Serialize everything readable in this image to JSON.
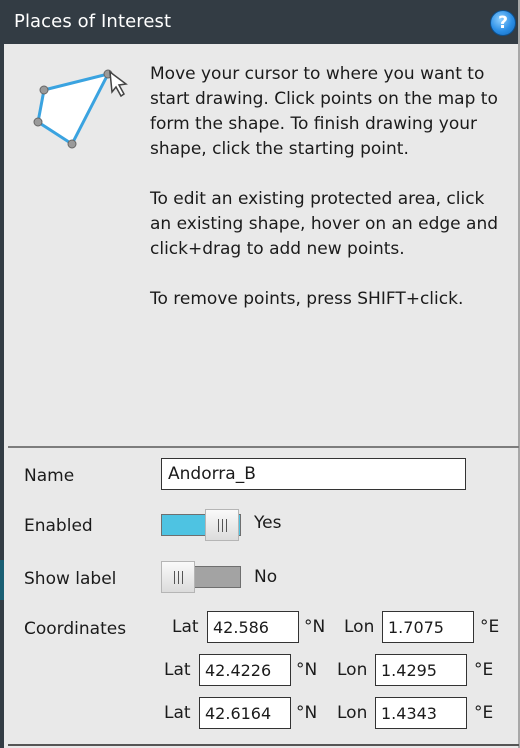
{
  "header": {
    "title": "Places of Interest",
    "help_glyph": "?",
    "help_icon": "help-circle-icon"
  },
  "instructions": {
    "icon": "polygon-draw-icon",
    "paragraphs": [
      "Move your cursor to where you want to start drawing. Click points on the map to form the shape. To finish drawing your shape, click the starting point.",
      "To edit an existing protected area, click an existing shape, hover on an edge and click+drag to add new points.",
      "To remove points, press SHIFT+click."
    ]
  },
  "form": {
    "name_label": "Name",
    "name_value": "Andorra_B",
    "enabled_label": "Enabled",
    "enabled_state": true,
    "enabled_text": "Yes",
    "show_label_label": "Show label",
    "show_label_state": false,
    "show_label_text": "No",
    "coordinates_label": "Coordinates",
    "coordinates": [
      {
        "lat_label": "Lat",
        "lat": "42.586",
        "lat_unit": "°N",
        "lon_label": "Lon",
        "lon": "1.7075",
        "lon_unit": "°E"
      },
      {
        "lat_label": "Lat",
        "lat": "42.4226",
        "lat_unit": "°N",
        "lon_label": "Lon",
        "lon": "1.4295",
        "lon_unit": "°E"
      },
      {
        "lat_label": "Lat",
        "lat": "42.6164",
        "lat_unit": "°N",
        "lon_label": "Lon",
        "lon": "1.4343",
        "lon_unit": "°E"
      }
    ]
  },
  "colors": {
    "header_bg": "#333c44",
    "panel_bg": "#e9e9e9",
    "toggle_on": "#4ec3e2",
    "toggle_off": "#a3a3a3",
    "polygon_stroke": "#3aa3e0"
  }
}
